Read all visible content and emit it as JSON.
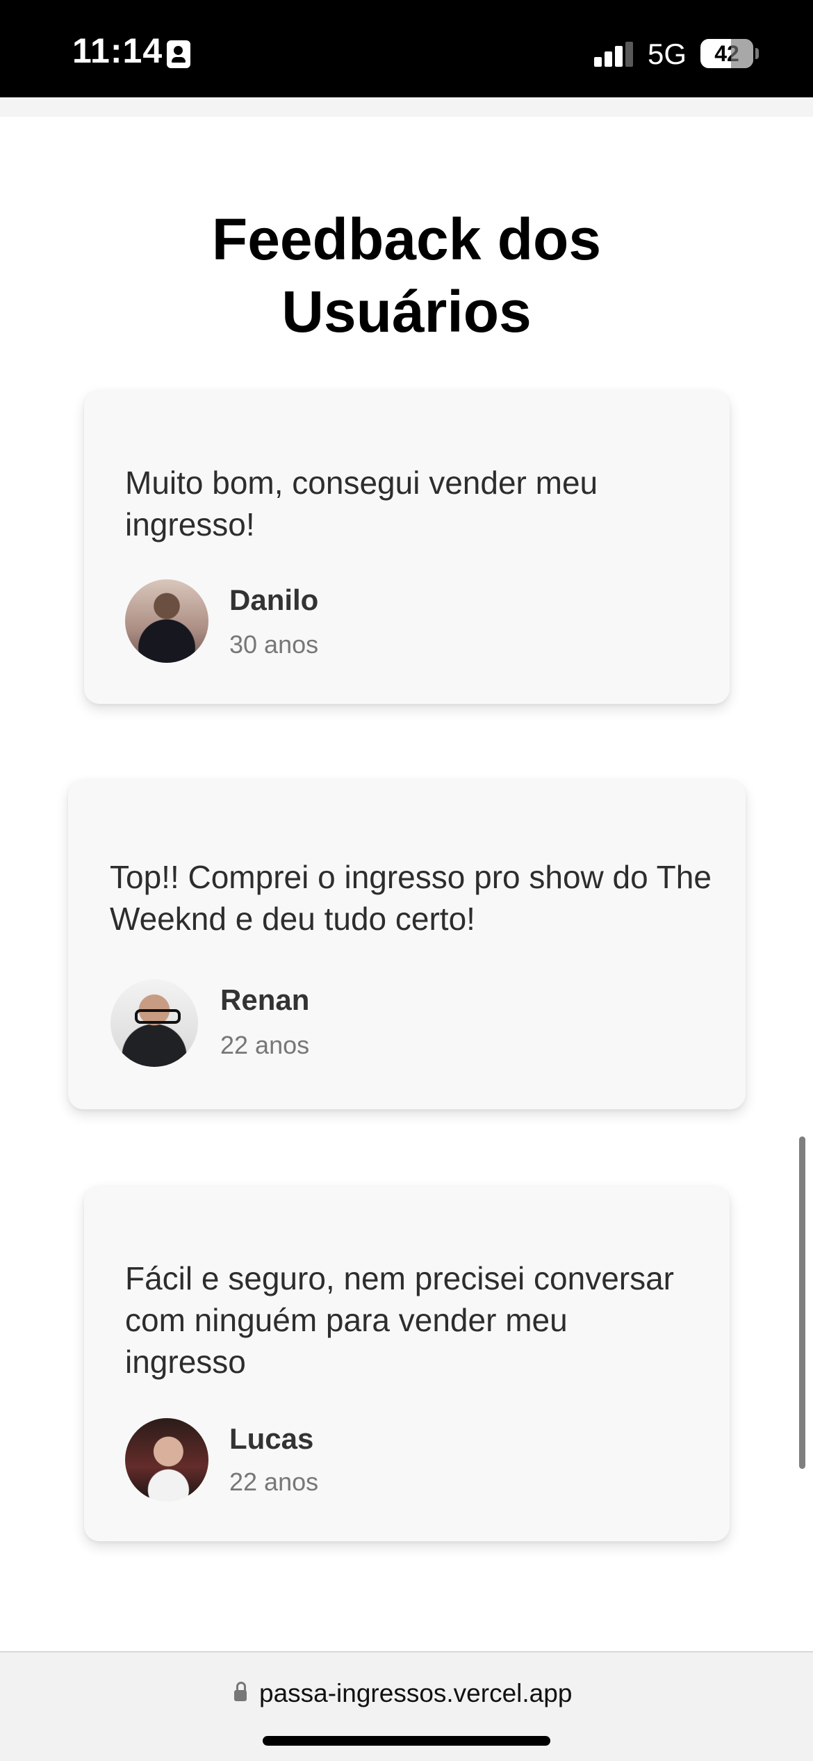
{
  "status_bar": {
    "time": "11:14",
    "network": "5G",
    "battery": "42"
  },
  "page": {
    "title_line_1": "Feedback dos",
    "title_line_2": "Usuários"
  },
  "testimonials": [
    {
      "text": "Muito bom, consegui vender meu ingresso!",
      "name": "Danilo",
      "age": "30 anos",
      "avatar": "person-avatar"
    },
    {
      "text": "Top!! Comprei o ingresso pro show do The Weeknd e deu tudo certo!",
      "name": "Renan",
      "age": "22 anos",
      "avatar": "person-avatar"
    },
    {
      "text": "Fácil e seguro, nem precisei conversar com ninguém para vender meu ingresso",
      "name": "Lucas",
      "age": "22 anos",
      "avatar": "person-avatar"
    }
  ],
  "browser": {
    "url": "passa-ingressos.vercel.app"
  },
  "icons": {
    "status_contact": "contact-card-icon",
    "status_signal": "signal-bars-icon",
    "status_battery": "battery-icon",
    "browser_lock": "lock-icon"
  },
  "colors": {
    "background": "#ffffff",
    "card_background": "#f8f8f8",
    "title_text": "#000000",
    "body_text": "#2d2d2d",
    "secondary_text": "#777777"
  }
}
